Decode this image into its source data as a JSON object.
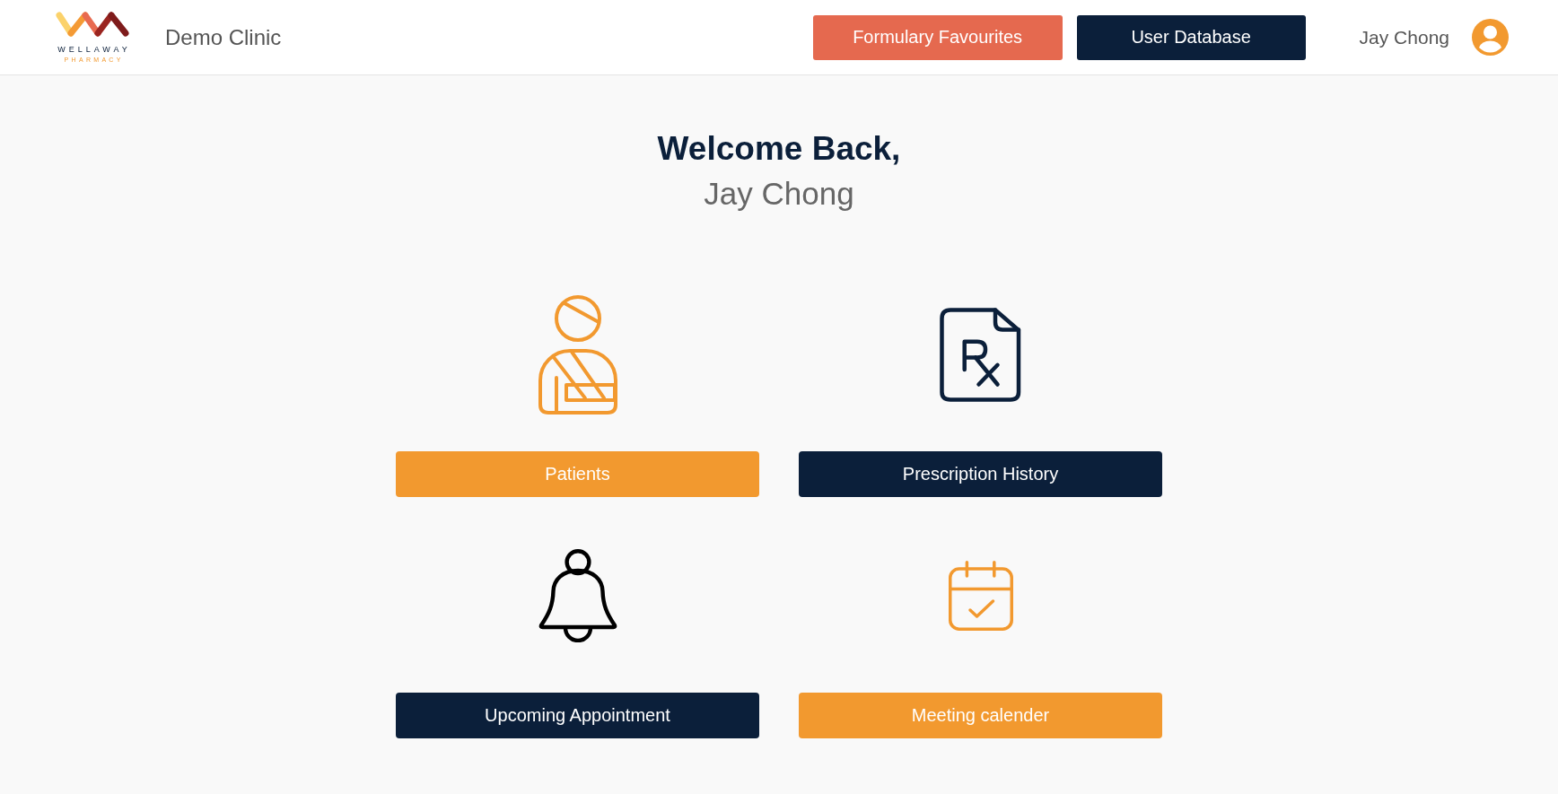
{
  "header": {
    "logo": {
      "name": "WELLAWAY",
      "tagline": "PHARMACY"
    },
    "clinic_name": "Demo Clinic",
    "buttons": [
      {
        "label": "Formulary Favourites",
        "color": "#e5694f"
      },
      {
        "label": "User Database",
        "color": "#0b1f3a"
      }
    ],
    "user_name": "Jay Chong"
  },
  "welcome": {
    "greeting": "Welcome Back,",
    "user_name": "Jay Chong"
  },
  "tiles": [
    {
      "kind": "patients",
      "label": "Patients",
      "color": "#f2992f"
    },
    {
      "kind": "prescriptions",
      "label": "Prescription History",
      "color": "#0b1f3a"
    },
    {
      "kind": "appointments",
      "label": "Upcoming Appointment",
      "color": "#0b1f3a"
    },
    {
      "kind": "calendar",
      "label": "Meeting calender",
      "color": "#f2992f"
    }
  ]
}
